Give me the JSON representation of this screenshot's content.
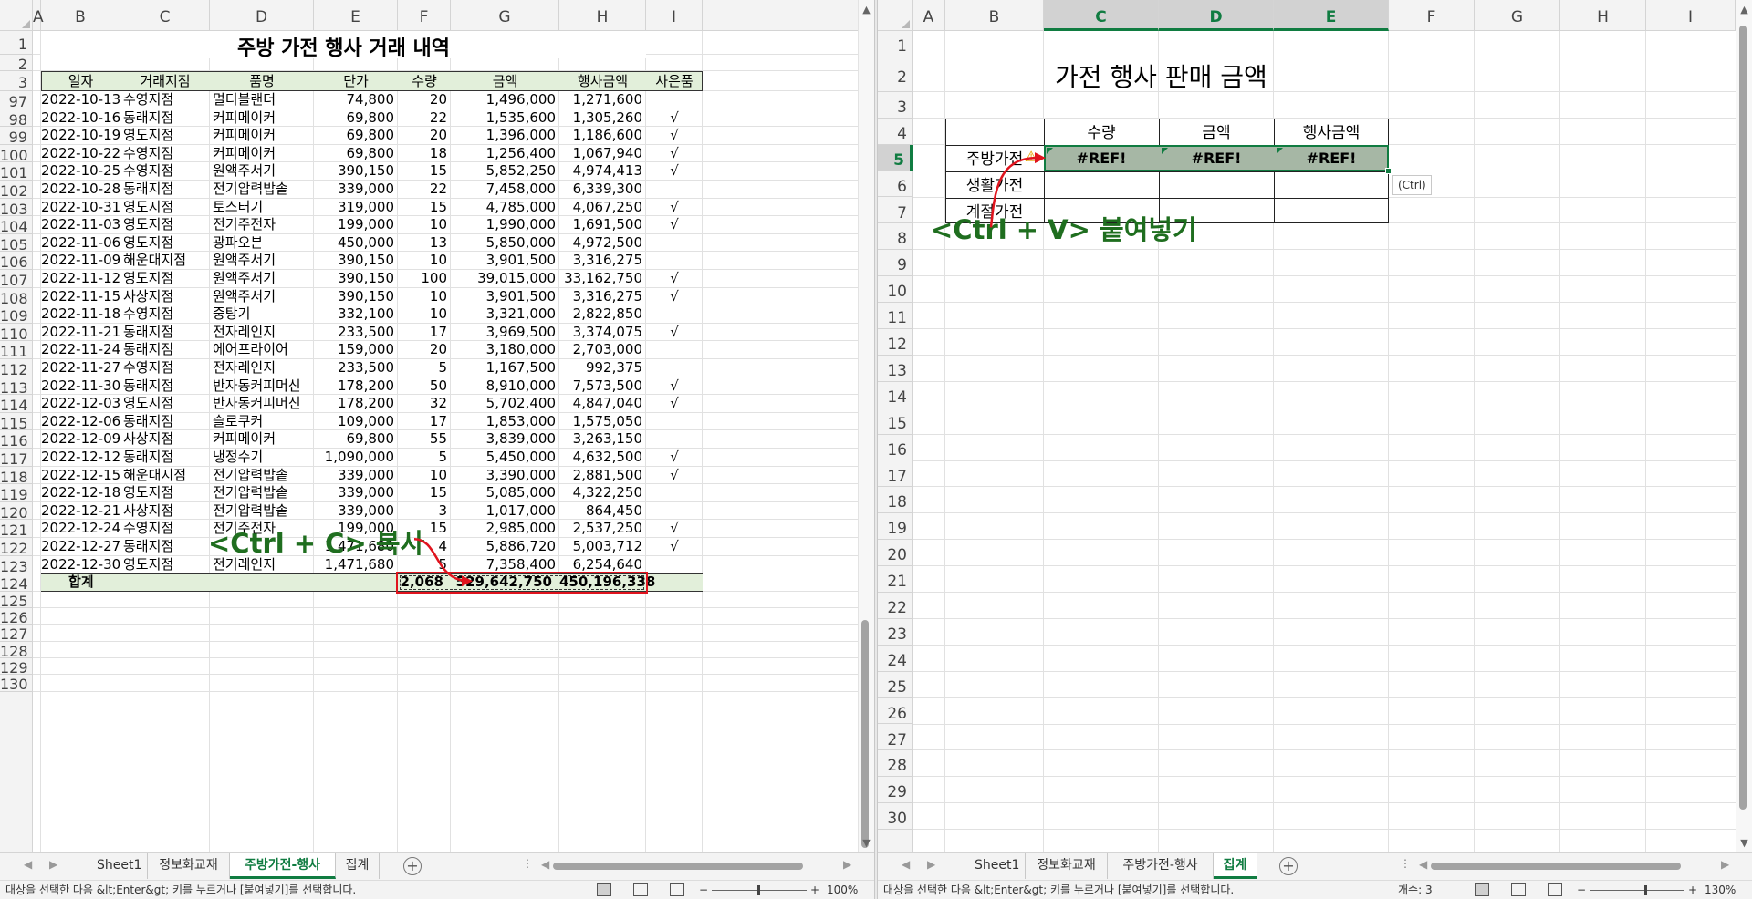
{
  "left": {
    "columns": [
      "A",
      "B",
      "C",
      "D",
      "E",
      "F",
      "G",
      "H",
      "I"
    ],
    "title": "주방 가전 행사 거래 내역",
    "headers": [
      "일자",
      "거래지점",
      "품명",
      "단가",
      "수량",
      "금액",
      "행사금액",
      "사은품"
    ],
    "rows": [
      {
        "n": "97",
        "date": "2022-10-13",
        "branch": "수영지점",
        "item": "멀티블랜더",
        "price": "74,800",
        "qty": "20",
        "amt": "1,496,000",
        "evt": "1,271,600",
        "gift": ""
      },
      {
        "n": "98",
        "date": "2022-10-16",
        "branch": "동래지점",
        "item": "커피메이커",
        "price": "69,800",
        "qty": "22",
        "amt": "1,535,600",
        "evt": "1,305,260",
        "gift": "√"
      },
      {
        "n": "99",
        "date": "2022-10-19",
        "branch": "영도지점",
        "item": "커피메이커",
        "price": "69,800",
        "qty": "20",
        "amt": "1,396,000",
        "evt": "1,186,600",
        "gift": "√"
      },
      {
        "n": "100",
        "date": "2022-10-22",
        "branch": "수영지점",
        "item": "커피메이커",
        "price": "69,800",
        "qty": "18",
        "amt": "1,256,400",
        "evt": "1,067,940",
        "gift": "√"
      },
      {
        "n": "101",
        "date": "2022-10-25",
        "branch": "수영지점",
        "item": "원액주서기",
        "price": "390,150",
        "qty": "15",
        "amt": "5,852,250",
        "evt": "4,974,413",
        "gift": "√"
      },
      {
        "n": "102",
        "date": "2022-10-28",
        "branch": "동래지점",
        "item": "전기압력밥솥",
        "price": "339,000",
        "qty": "22",
        "amt": "7,458,000",
        "evt": "6,339,300",
        "gift": ""
      },
      {
        "n": "103",
        "date": "2022-10-31",
        "branch": "영도지점",
        "item": "토스터기",
        "price": "319,000",
        "qty": "15",
        "amt": "4,785,000",
        "evt": "4,067,250",
        "gift": "√"
      },
      {
        "n": "104",
        "date": "2022-11-03",
        "branch": "영도지점",
        "item": "전기주전자",
        "price": "199,000",
        "qty": "10",
        "amt": "1,990,000",
        "evt": "1,691,500",
        "gift": "√"
      },
      {
        "n": "105",
        "date": "2022-11-06",
        "branch": "영도지점",
        "item": "광파오븐",
        "price": "450,000",
        "qty": "13",
        "amt": "5,850,000",
        "evt": "4,972,500",
        "gift": ""
      },
      {
        "n": "106",
        "date": "2022-11-09",
        "branch": "해운대지점",
        "item": "원액주서기",
        "price": "390,150",
        "qty": "10",
        "amt": "3,901,500",
        "evt": "3,316,275",
        "gift": ""
      },
      {
        "n": "107",
        "date": "2022-11-12",
        "branch": "영도지점",
        "item": "원액주서기",
        "price": "390,150",
        "qty": "100",
        "amt": "39,015,000",
        "evt": "33,162,750",
        "gift": "√"
      },
      {
        "n": "108",
        "date": "2022-11-15",
        "branch": "사상지점",
        "item": "원액주서기",
        "price": "390,150",
        "qty": "10",
        "amt": "3,901,500",
        "evt": "3,316,275",
        "gift": "√"
      },
      {
        "n": "109",
        "date": "2022-11-18",
        "branch": "수영지점",
        "item": "중탕기",
        "price": "332,100",
        "qty": "10",
        "amt": "3,321,000",
        "evt": "2,822,850",
        "gift": ""
      },
      {
        "n": "110",
        "date": "2022-11-21",
        "branch": "동래지점",
        "item": "전자레인지",
        "price": "233,500",
        "qty": "17",
        "amt": "3,969,500",
        "evt": "3,374,075",
        "gift": "√"
      },
      {
        "n": "111",
        "date": "2022-11-24",
        "branch": "동래지점",
        "item": "에어프라이어",
        "price": "159,000",
        "qty": "20",
        "amt": "3,180,000",
        "evt": "2,703,000",
        "gift": ""
      },
      {
        "n": "112",
        "date": "2022-11-27",
        "branch": "수영지점",
        "item": "전자레인지",
        "price": "233,500",
        "qty": "5",
        "amt": "1,167,500",
        "evt": "992,375",
        "gift": ""
      },
      {
        "n": "113",
        "date": "2022-11-30",
        "branch": "동래지점",
        "item": "반자동커피머신",
        "price": "178,200",
        "qty": "50",
        "amt": "8,910,000",
        "evt": "7,573,500",
        "gift": "√"
      },
      {
        "n": "114",
        "date": "2022-12-03",
        "branch": "영도지점",
        "item": "반자동커피머신",
        "price": "178,200",
        "qty": "32",
        "amt": "5,702,400",
        "evt": "4,847,040",
        "gift": "√"
      },
      {
        "n": "115",
        "date": "2022-12-06",
        "branch": "동래지점",
        "item": "슬로쿠커",
        "price": "109,000",
        "qty": "17",
        "amt": "1,853,000",
        "evt": "1,575,050",
        "gift": ""
      },
      {
        "n": "116",
        "date": "2022-12-09",
        "branch": "사상지점",
        "item": "커피메이커",
        "price": "69,800",
        "qty": "55",
        "amt": "3,839,000",
        "evt": "3,263,150",
        "gift": ""
      },
      {
        "n": "117",
        "date": "2022-12-12",
        "branch": "동래지점",
        "item": "냉정수기",
        "price": "1,090,000",
        "qty": "5",
        "amt": "5,450,000",
        "evt": "4,632,500",
        "gift": "√"
      },
      {
        "n": "118",
        "date": "2022-12-15",
        "branch": "해운대지점",
        "item": "전기압력밥솥",
        "price": "339,000",
        "qty": "10",
        "amt": "3,390,000",
        "evt": "2,881,500",
        "gift": "√"
      },
      {
        "n": "119",
        "date": "2022-12-18",
        "branch": "영도지점",
        "item": "전기압력밥솥",
        "price": "339,000",
        "qty": "15",
        "amt": "5,085,000",
        "evt": "4,322,250",
        "gift": ""
      },
      {
        "n": "120",
        "date": "2022-12-21",
        "branch": "사상지점",
        "item": "전기압력밥솥",
        "price": "339,000",
        "qty": "3",
        "amt": "1,017,000",
        "evt": "864,450",
        "gift": ""
      },
      {
        "n": "121",
        "date": "2022-12-24",
        "branch": "수영지점",
        "item": "전기주전자",
        "price": "199,000",
        "qty": "15",
        "amt": "2,985,000",
        "evt": "2,537,250",
        "gift": "√"
      },
      {
        "n": "122",
        "date": "2022-12-27",
        "branch": "동래지점",
        "item": "",
        "price": "1,471,680",
        "qty": "4",
        "amt": "5,886,720",
        "evt": "5,003,712",
        "gift": "√"
      },
      {
        "n": "123",
        "date": "2022-12-30",
        "branch": "영도지점",
        "item": "전기레인지",
        "price": "1,471,680",
        "qty": "5",
        "amt": "7,358,400",
        "evt": "6,254,640",
        "gift": ""
      }
    ],
    "total": {
      "n": "124",
      "label": "합계",
      "qty": "2,068",
      "amt": "529,642,750",
      "evt": "450,196,338"
    },
    "empty_rows": [
      "125",
      "126",
      "127",
      "128",
      "129",
      "130"
    ],
    "header_row_nums": [
      "1",
      "2",
      "3"
    ],
    "callout": "<Ctrl + C> 복사",
    "tabs": [
      "Sheet1",
      "정보화교재",
      "주방가전-행사",
      "집계"
    ],
    "active_tab": "주방가전-행사",
    "status": "대상을 선택한 다음 &lt;Enter&gt; 키를 누르거나 [붙여넣기]를 선택합니다.",
    "zoom": "100%"
  },
  "right": {
    "columns": [
      "A",
      "B",
      "C",
      "D",
      "E",
      "F",
      "G",
      "H",
      "I"
    ],
    "row_nums": [
      "1",
      "2",
      "3",
      "4",
      "5",
      "6",
      "7",
      "8",
      "9",
      "10",
      "11",
      "12",
      "13",
      "14",
      "15",
      "16",
      "17",
      "18",
      "19",
      "20",
      "21",
      "22",
      "23",
      "24",
      "25",
      "26",
      "27",
      "28",
      "29",
      "30"
    ],
    "title": "가전 행사 판매 금액",
    "table_headers": [
      "수량",
      "금액",
      "행사금액"
    ],
    "row_labels": [
      "주방가전",
      "생활가전",
      "계절가전"
    ],
    "ref_error": "#REF!",
    "paste_options": "(Ctrl)",
    "callout": "<Ctrl + V> 붙여넣기",
    "tabs": [
      "Sheet1",
      "정보화교재",
      "주방가전-행사",
      "집계"
    ],
    "active_tab": "집계",
    "status": "대상을 선택한 다음 &lt;Enter&gt; 키를 누르거나 [붙여넣기]를 선택합니다.",
    "count_label": "개수: 3",
    "zoom": "130%"
  },
  "colors": {
    "accent": "#107c41",
    "header_fill": "#e2efda",
    "selection_fill": "#a6b7a5",
    "annotation_red": "#e0141e",
    "callout_green": "#1f6e1f"
  }
}
